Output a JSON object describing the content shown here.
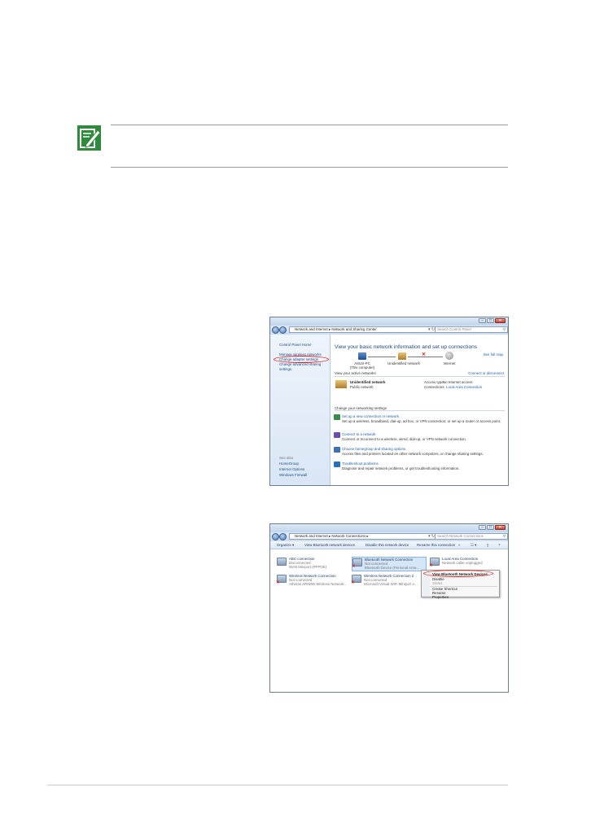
{
  "note": {
    "icon": "note-pencil-icon"
  },
  "screenshot1": {
    "address": [
      "Network and Internet",
      "Network and Sharing Center"
    ],
    "search_placeholder": "Search Control Panel",
    "sidebar": {
      "home": "Control Panel Home",
      "links": [
        "Manage wireless networks",
        "Change adapter settings",
        "Change advanced sharing settings"
      ],
      "see_also_label": "See also",
      "see_also": [
        "HomeGroup",
        "Internet Options",
        "Windows Firewall"
      ]
    },
    "title": "View your basic network information and set up connections",
    "see_full_map": "See full map",
    "map_nodes": [
      "ASUS-PC",
      "(This computer)",
      "Unidentified network",
      "Internet"
    ],
    "active_networks_label": "View your active networks",
    "connect_disconnect": "Connect or disconnect",
    "network_name": "Unidentified network",
    "network_type": "Public network",
    "access_type_label": "Access type:",
    "access_type_value": "No Internet access",
    "connections_label": "Connections:",
    "connections_value": "Local Area Connection",
    "change_settings_label": "Change your networking settings",
    "tasks": [
      {
        "title": "Set up a new connection or network",
        "desc": "Set up a wireless, broadband, dial-up, ad hoc, or VPN connection; or set up a router or access point."
      },
      {
        "title": "Connect to a network",
        "desc": "Connect or reconnect to a wireless, wired, dial-up, or VPN network connection."
      },
      {
        "title": "Choose homegroup and sharing options",
        "desc": "Access files and printers located on other network computers, or change sharing settings."
      },
      {
        "title": "Troubleshoot problems",
        "desc": "Diagnose and repair network problems, or get troubleshooting information."
      }
    ]
  },
  "screenshot2": {
    "address": [
      "Network and Internet",
      "Network Connections"
    ],
    "search_placeholder": "Search Network Connections",
    "toolbar": [
      "Organize ▾",
      "View Bluetooth network devices",
      "Disable this network device",
      "Rename this connection",
      "»"
    ],
    "connections": [
      {
        "name": "ABC connection",
        "status": "Disconnected",
        "device": "WAN Miniport (PPPOE)"
      },
      {
        "name": "Bluetooth Network Connection",
        "status": "Not connected",
        "device": "Bluetooth Device (Personal Area..."
      },
      {
        "name": "Local Area Connection",
        "status": "Network cable unplugged",
        "device": ""
      },
      {
        "name": "Wireless Network Connection",
        "status": "Not connected",
        "device": "Atheros AR9285 Wireless Network..."
      },
      {
        "name": "Wireless Network Connection 2",
        "status": "Not connected",
        "device": "Microsoft Virtual WiFi Miniport A..."
      }
    ],
    "context_menu": [
      "View Bluetooth Network Devices",
      "Disable",
      "Status",
      "Create Shortcut",
      "Rename",
      "Properties"
    ]
  }
}
